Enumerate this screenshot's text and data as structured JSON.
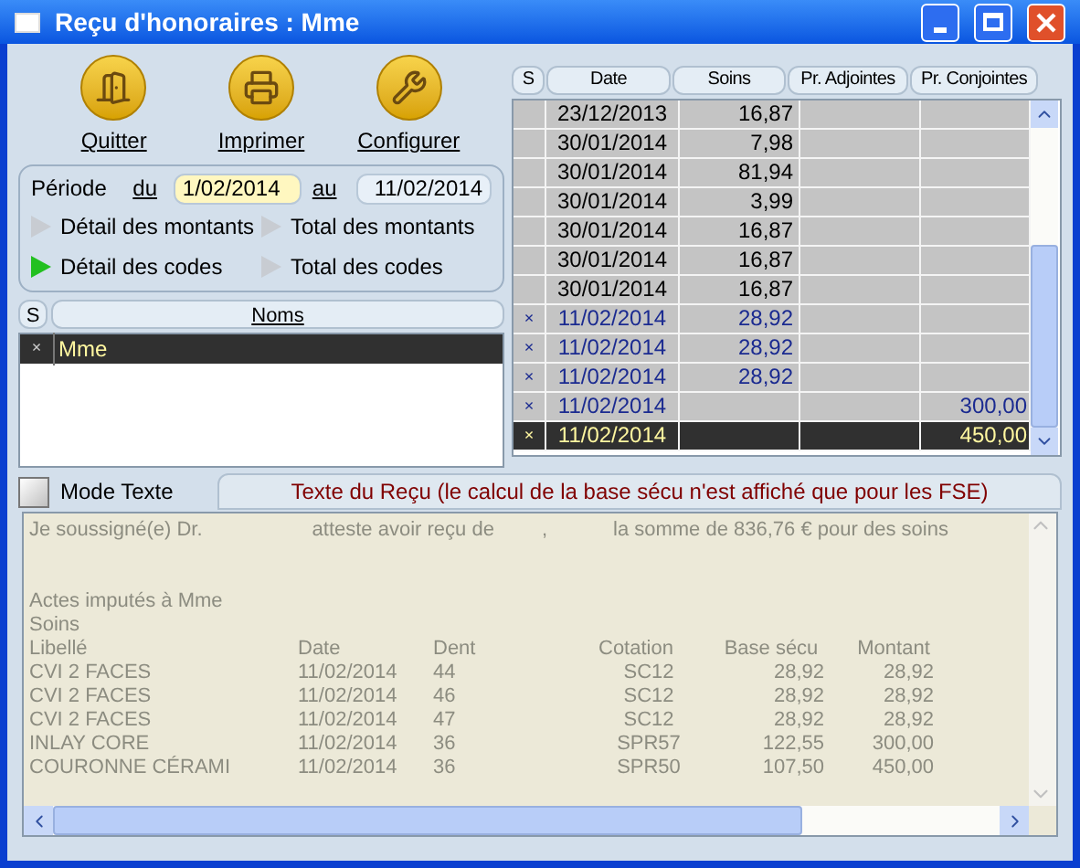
{
  "window": {
    "title": "Reçu d'honoraires : Mme"
  },
  "toolbar": [
    {
      "label": "Quitter",
      "kind": "door"
    },
    {
      "label": "Imprimer",
      "kind": "printer"
    },
    {
      "label": "Configurer",
      "kind": "wrench"
    }
  ],
  "period": {
    "label": "Période",
    "from_label": "du",
    "from": "1/02/2014",
    "to_label": "au",
    "to": "11/02/2014"
  },
  "options": [
    {
      "label": "Détail des montants",
      "selected": false
    },
    {
      "label": "Total des montants",
      "selected": false
    },
    {
      "label": "Détail des codes",
      "selected": true
    },
    {
      "label": "Total des codes",
      "selected": false
    }
  ],
  "names_list": {
    "columns": [
      "S",
      "Noms"
    ],
    "rows": [
      {
        "s": "×",
        "name": "Mme",
        "selected": true
      }
    ]
  },
  "grid": {
    "columns": [
      "S",
      "Date",
      "Soins",
      "Pr. Adjointes",
      "Pr. Conjointes"
    ],
    "rows": [
      {
        "s": "",
        "date": "23/12/2013",
        "soins": "16,87",
        "adjointes": "",
        "conjointes": "",
        "marked": false,
        "selected": false
      },
      {
        "s": "",
        "date": "30/01/2014",
        "soins": "7,98",
        "adjointes": "",
        "conjointes": "",
        "marked": false,
        "selected": false
      },
      {
        "s": "",
        "date": "30/01/2014",
        "soins": "81,94",
        "adjointes": "",
        "conjointes": "",
        "marked": false,
        "selected": false
      },
      {
        "s": "",
        "date": "30/01/2014",
        "soins": "3,99",
        "adjointes": "",
        "conjointes": "",
        "marked": false,
        "selected": false
      },
      {
        "s": "",
        "date": "30/01/2014",
        "soins": "16,87",
        "adjointes": "",
        "conjointes": "",
        "marked": false,
        "selected": false
      },
      {
        "s": "",
        "date": "30/01/2014",
        "soins": "16,87",
        "adjointes": "",
        "conjointes": "",
        "marked": false,
        "selected": false
      },
      {
        "s": "",
        "date": "30/01/2014",
        "soins": "16,87",
        "adjointes": "",
        "conjointes": "",
        "marked": false,
        "selected": false
      },
      {
        "s": "×",
        "date": "11/02/2014",
        "soins": "28,92",
        "adjointes": "",
        "conjointes": "",
        "marked": true,
        "selected": false
      },
      {
        "s": "×",
        "date": "11/02/2014",
        "soins": "28,92",
        "adjointes": "",
        "conjointes": "",
        "marked": true,
        "selected": false
      },
      {
        "s": "×",
        "date": "11/02/2014",
        "soins": "28,92",
        "adjointes": "",
        "conjointes": "",
        "marked": true,
        "selected": false
      },
      {
        "s": "×",
        "date": "11/02/2014",
        "soins": "",
        "adjointes": "",
        "conjointes": "300,00",
        "marked": true,
        "selected": false
      },
      {
        "s": "×",
        "date": "11/02/2014",
        "soins": "",
        "adjointes": "",
        "conjointes": "450,00",
        "marked": true,
        "selected": true
      }
    ]
  },
  "mode_texte": {
    "label": "Mode Texte",
    "checked": false
  },
  "receipt": {
    "title": "Texte du Reçu (le calcul de la base sécu n'est affiché que pour les FSE)",
    "line_parts": [
      "Je soussigné(e) Dr.",
      "atteste avoir reçu de",
      ",",
      "la somme de 836,76 € pour des soins"
    ],
    "actes": "Actes imputés à Mme",
    "section": "Soins",
    "columns": [
      "Libellé",
      "Date",
      "Dent",
      "Cotation",
      "Base sécu",
      "Montant"
    ],
    "rows": [
      [
        "CVI 2 FACES",
        "11/02/2014",
        "44",
        "SC12",
        "28,92",
        "28,92"
      ],
      [
        "CVI 2 FACES",
        "11/02/2014",
        "46",
        "SC12",
        "28,92",
        "28,92"
      ],
      [
        "CVI 2 FACES",
        "11/02/2014",
        "47",
        "SC12",
        "28,92",
        "28,92"
      ],
      [
        "INLAY CORE",
        "11/02/2014",
        "36",
        "SPR57",
        "122,55",
        "300,00"
      ],
      [
        "COURONNE CÉRAMI",
        "11/02/2014",
        "36",
        "SPR50",
        "107,50",
        "450,00"
      ]
    ]
  }
}
